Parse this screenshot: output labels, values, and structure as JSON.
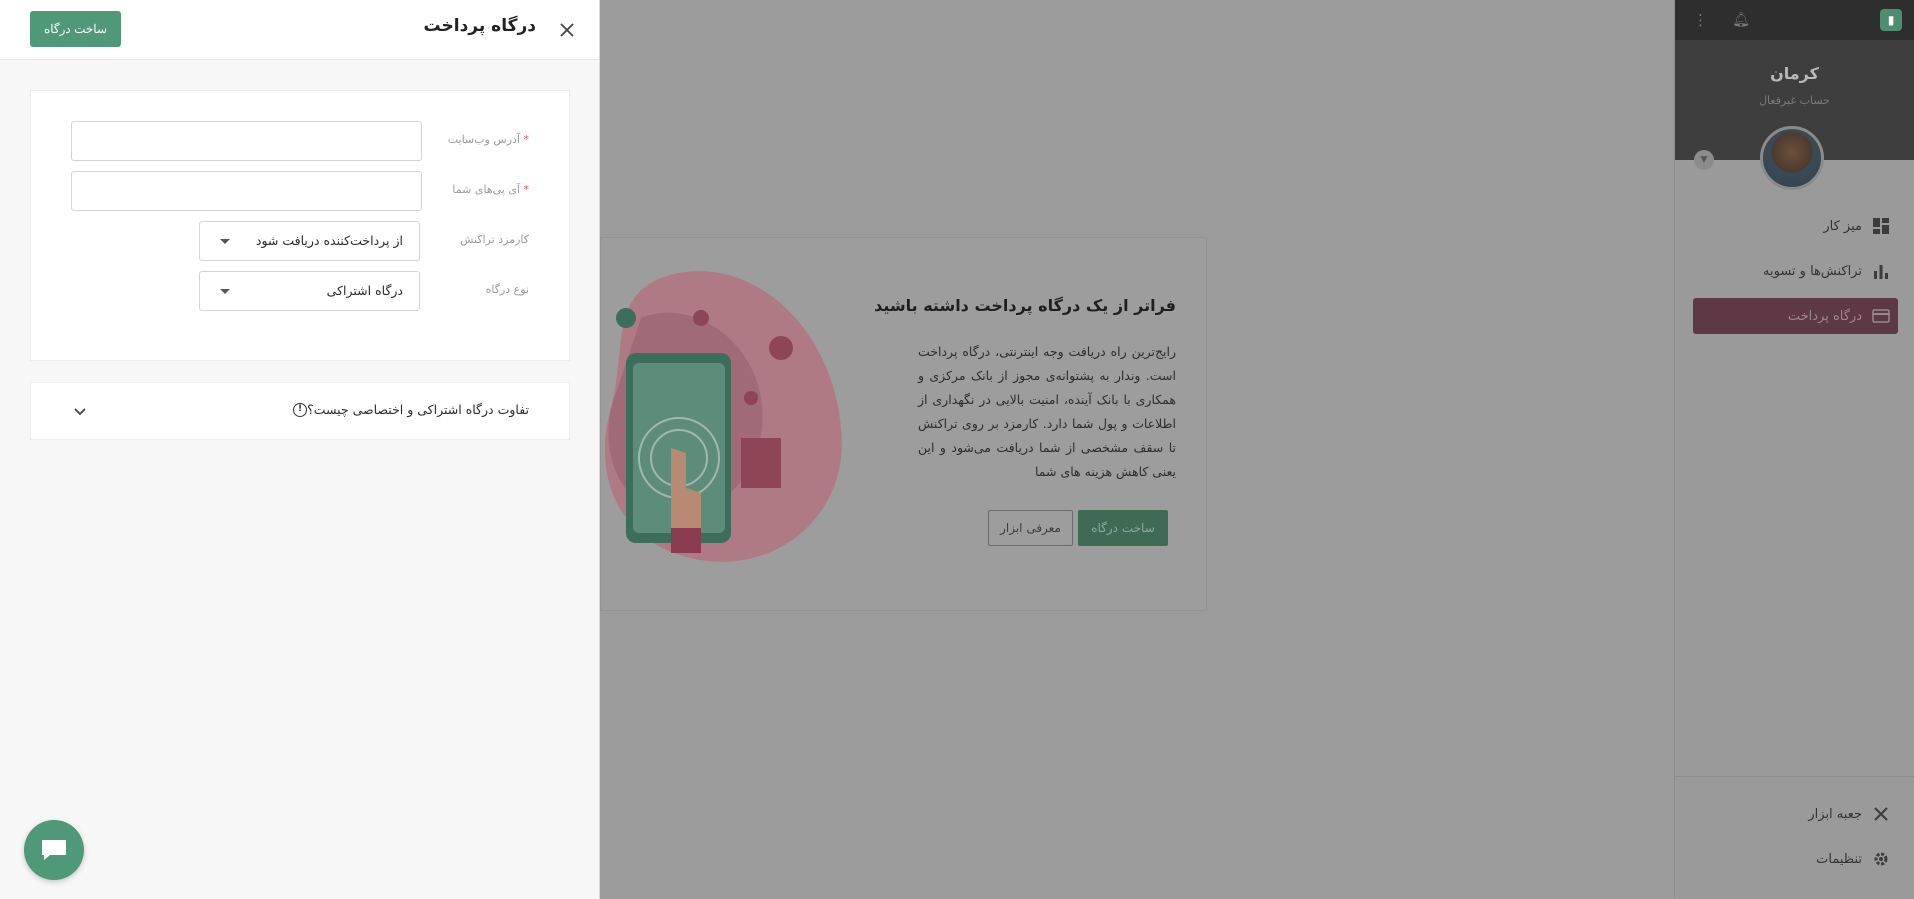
{
  "sidebar": {
    "account_name": "کرمان",
    "account_type": "حساب غیرفعال",
    "menu": [
      {
        "label": "میز کار",
        "icon": "dashboard-icon"
      },
      {
        "label": "تراکنش‌ها و تسویه",
        "icon": "bar-chart-icon"
      },
      {
        "label": "درگاه پرداخت",
        "icon": "card-icon"
      }
    ],
    "bottom_menu": [
      {
        "label": "جعبه ابزار",
        "icon": "tools-icon"
      },
      {
        "label": "تنظیمات",
        "icon": "gear-icon"
      }
    ]
  },
  "promo": {
    "title": "فراتر از یک درگاه پرداخت داشته باشید",
    "body": "رایج‌ترین راه دریافت وجه اینترنتی، درگاه پرداخت است. وندار به پشتوانه‌ی مجوز از بانک مرکزی و همکاری با بانک آینده، امنیت بالایی در نگهداری از اطلاعات و پول شما دارد. کارمزد بر روی تراکنش تا سقف مشخصی از شما دریافت می‌شود و این یعنی کاهش هزینه های شما",
    "primary_button": "ساخت درگاه",
    "secondary_button": "معرفی ابزار"
  },
  "drawer": {
    "title": "درگاه پرداخت",
    "submit_button": "ساخت درگاه",
    "fields": {
      "website": {
        "label": "آدرس وب‌سایت",
        "required_mark": "*",
        "value": ""
      },
      "ips": {
        "label": "آی پی‌های شما",
        "required_mark": "*",
        "value": ""
      },
      "fee": {
        "label": "کارمزد تراکنش",
        "value": "از پرداخت‌کننده دریافت شود"
      },
      "gateway_type": {
        "label": "نوع درگاه",
        "value": "درگاه اشتراکی"
      }
    },
    "faq": {
      "question": "تفاوت درگاه اشتراکی و اختصاصی چیست؟"
    }
  },
  "colors": {
    "primary": "#4f9878",
    "active_menu": "#5d3946",
    "overlay": "#9b9b9b"
  }
}
